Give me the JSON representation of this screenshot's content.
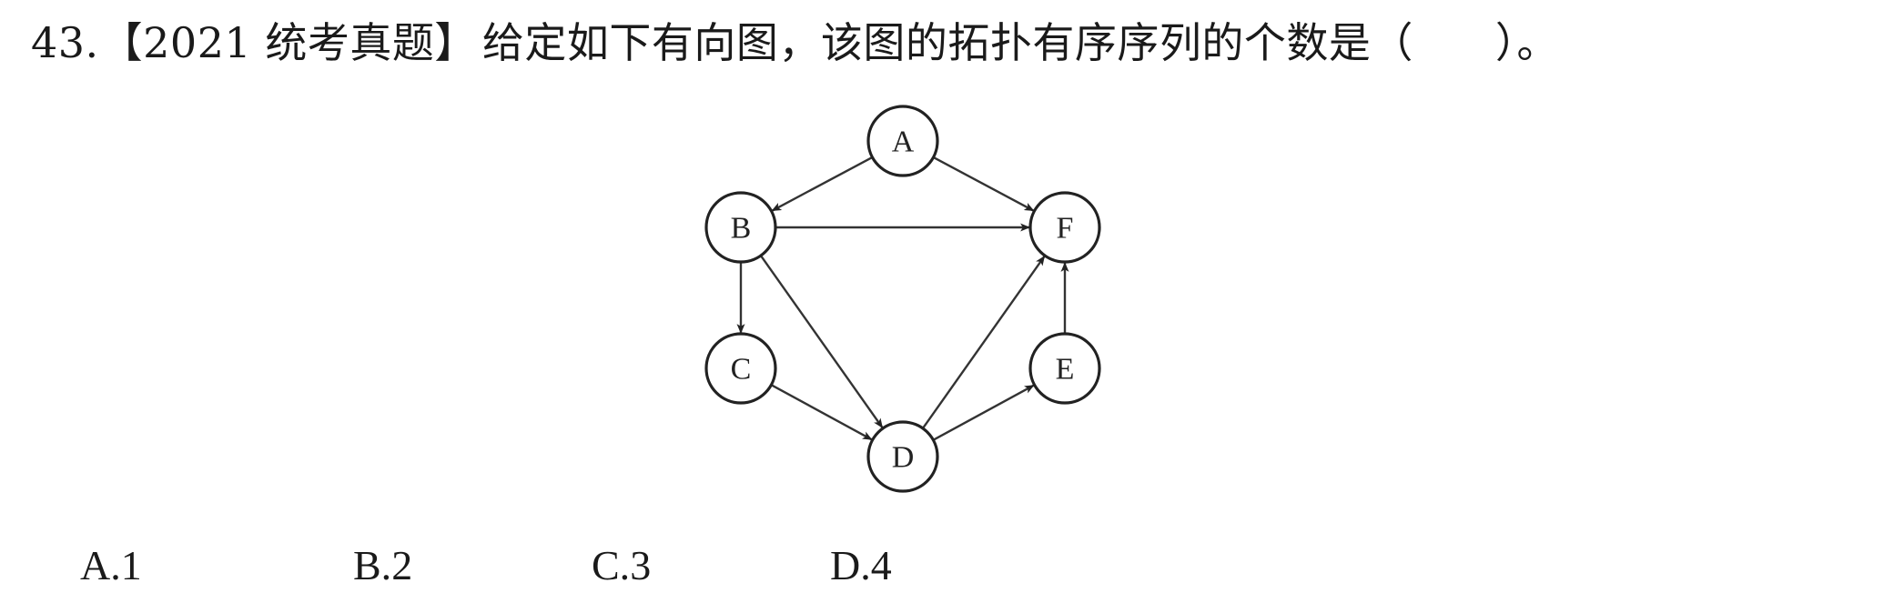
{
  "question": {
    "number": "43.",
    "tag": "【2021 统考真题】",
    "stem": "给定如下有向图，该图的拓扑有序序列的个数是（",
    "close": "）。"
  },
  "diagram": {
    "nodes": [
      {
        "id": "A",
        "label": "A"
      },
      {
        "id": "B",
        "label": "B"
      },
      {
        "id": "C",
        "label": "C"
      },
      {
        "id": "D",
        "label": "D"
      },
      {
        "id": "E",
        "label": "E"
      },
      {
        "id": "F",
        "label": "F"
      }
    ],
    "edges": [
      {
        "from": "A",
        "to": "B"
      },
      {
        "from": "A",
        "to": "F"
      },
      {
        "from": "B",
        "to": "F"
      },
      {
        "from": "B",
        "to": "C"
      },
      {
        "from": "B",
        "to": "D"
      },
      {
        "from": "C",
        "to": "D"
      },
      {
        "from": "D",
        "to": "F"
      },
      {
        "from": "D",
        "to": "E"
      },
      {
        "from": "E",
        "to": "F"
      }
    ]
  },
  "options": [
    {
      "letter": "A.",
      "value": "1"
    },
    {
      "letter": "B.",
      "value": "2"
    },
    {
      "letter": "C.",
      "value": "3"
    },
    {
      "letter": "D.",
      "value": "4"
    }
  ]
}
